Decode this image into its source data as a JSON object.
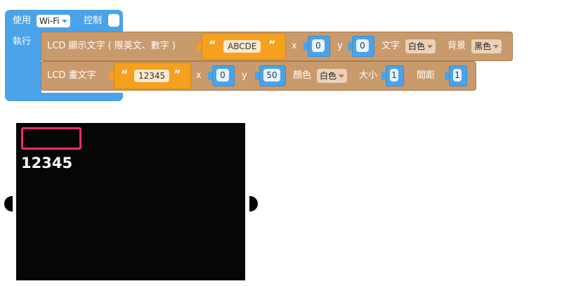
{
  "wifi": {
    "label_use": "使用",
    "protocol": "Wi-Fi",
    "label_control": "控制",
    "label_execute": "執行"
  },
  "lcd_text_block": {
    "label": "LCD 顯示文字 ( 限英文、數字 )",
    "text_value": "ABCDE",
    "label_x": "x",
    "x_value": "0",
    "label_y": "y",
    "y_value": "0",
    "label_text_color": "文字",
    "text_color": "白色",
    "label_background": "背景",
    "background_color": "黑色"
  },
  "lcd_draw_block": {
    "label": "LCD 畫文字",
    "text_value": "12345",
    "label_x": "x",
    "x_value": "0",
    "label_y": "y",
    "y_value": "50",
    "label_color": "顏色",
    "color": "白色",
    "label_size": "大小",
    "size_value": "1",
    "label_spacing": "間距",
    "spacing_value": "1"
  },
  "lcd_display": {
    "rendered_text": "12345"
  },
  "colors": {
    "wifi_block": "#4aa3e8",
    "lcd_block": "#c99a6b",
    "string_block": "#f5a01f",
    "highlight_rect": "#e8306a",
    "screen_bg": "#060606"
  },
  "quotes": {
    "open": "“",
    "close": "”"
  }
}
